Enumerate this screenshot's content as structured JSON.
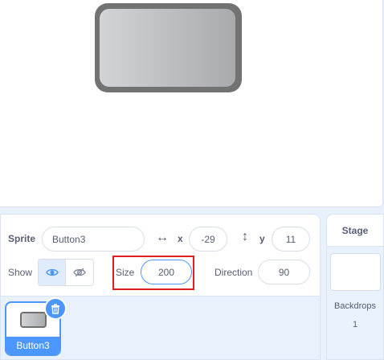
{
  "sprite_info": {
    "sprite_label": "Sprite",
    "sprite_name": "Button3",
    "x_label": "x",
    "x_value": "-29",
    "y_label": "y",
    "y_value": "11",
    "show_label": "Show",
    "size_label": "Size",
    "size_value": "200",
    "direction_label": "Direction",
    "direction_value": "90",
    "x_icon": "↔",
    "y_icon": "↕"
  },
  "sprite_list": {
    "items": [
      {
        "name": "Button3",
        "selected": true
      }
    ]
  },
  "stage_pane": {
    "header": "Stage",
    "backdrops_label": "Backdrops",
    "backdrops_count": "1"
  },
  "icons": {
    "show_visible": "eye-icon",
    "show_hidden": "eye-slash-icon",
    "delete": "trash-icon"
  },
  "colors": {
    "accent": "#4c97ff",
    "highlight_box": "#e0201f",
    "text": "#575e75"
  }
}
